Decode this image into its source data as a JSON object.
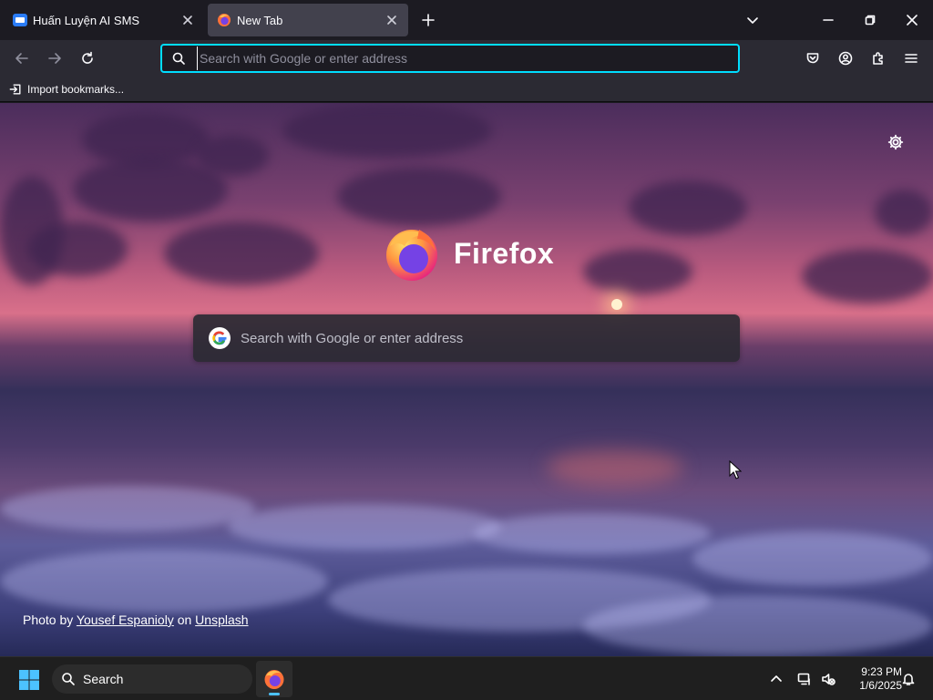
{
  "tabs": [
    {
      "title": "Huấn Luyện AI SMS",
      "favicon": "zalo-favicon",
      "active": false
    },
    {
      "title": "New Tab",
      "favicon": "firefox-favicon",
      "active": true
    }
  ],
  "toolbar": {
    "url_placeholder": "Search with Google or enter address",
    "icons": [
      "back-arrow-icon",
      "forward-arrow-icon",
      "reload-icon",
      "pocket-icon",
      "account-icon",
      "extensions-icon",
      "menu-icon"
    ]
  },
  "bookmarks": {
    "import_label": "Import bookmarks..."
  },
  "newtab": {
    "brand_name": "Firefox",
    "search_placeholder": "Search with Google or enter address",
    "attribution": {
      "prefix": "Photo by",
      "author": "Yousef Espanioly",
      "middle": "on",
      "site": "Unsplash"
    }
  },
  "taskbar": {
    "search_label": "Search",
    "time": "9:23 PM",
    "date": "1/6/2025"
  },
  "colors": {
    "accent": "#00ddff",
    "taskbar_indicator": "#4cc2ff"
  }
}
